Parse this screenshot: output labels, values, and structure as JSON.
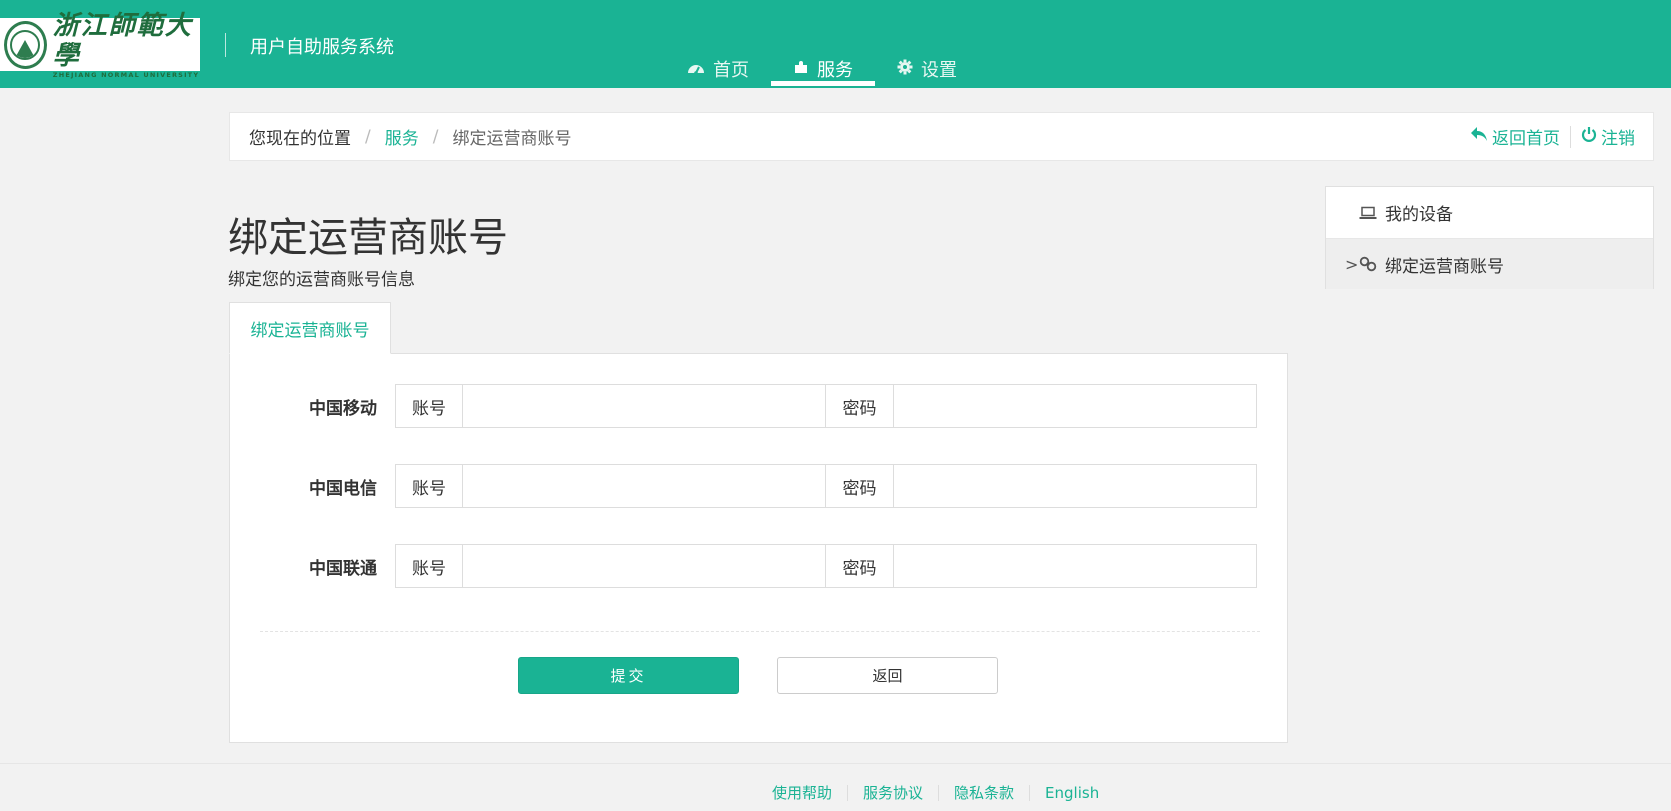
{
  "header": {
    "logo_cn": "浙江師範大學",
    "logo_en": "ZHEJIANG NORMAL UNIVERSITY",
    "system_title": "用户自助服务系统",
    "nav": [
      {
        "label": "首页",
        "icon": "dashboard-icon"
      },
      {
        "label": "服务",
        "icon": "puzzle-icon",
        "active": true
      },
      {
        "label": "设置",
        "icon": "gear-icon"
      }
    ]
  },
  "breadcrumb": {
    "location_label": "您现在的位置",
    "separator": "/",
    "service": "服务",
    "current": "绑定运营商账号",
    "home_action": "返回首页",
    "logout_action": "注销"
  },
  "page": {
    "title": "绑定运营商账号",
    "subtitle": "绑定您的运营商账号信息"
  },
  "tab": {
    "label": "绑定运营商账号"
  },
  "form": {
    "account_label": "账号",
    "password_label": "密码",
    "rows": [
      {
        "carrier": "中国移动",
        "account": "",
        "password": ""
      },
      {
        "carrier": "中国电信",
        "account": "",
        "password": ""
      },
      {
        "carrier": "中国联通",
        "account": "",
        "password": ""
      }
    ],
    "submit_label": "提交",
    "back_label": "返回"
  },
  "sidebar": {
    "items": [
      {
        "label": "我的设备",
        "icon": "laptop-icon"
      },
      {
        "label": "绑定运营商账号",
        "icon": "link-icon",
        "active": true,
        "caret": ">"
      }
    ]
  },
  "footer": {
    "links": [
      "使用帮助",
      "服务协议",
      "隐私条款",
      "English"
    ]
  },
  "colors": {
    "brand": "#1ab394",
    "background": "#f2f2f2"
  }
}
